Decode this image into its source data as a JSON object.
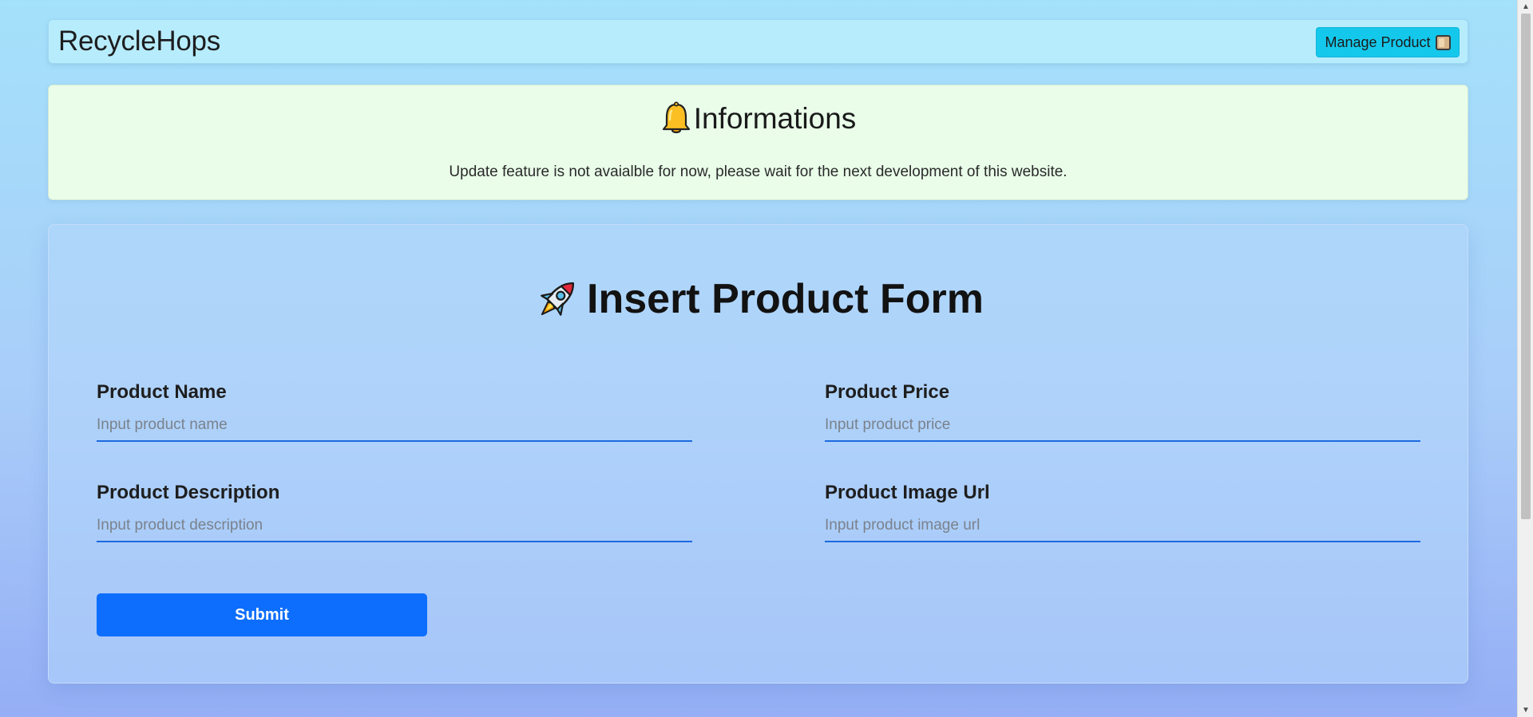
{
  "navbar": {
    "brand": "RecycleHops",
    "manage_button_label": "Manage Product",
    "manage_button_icon": "package-icon"
  },
  "info": {
    "icon": "bell-icon",
    "title": "Informations",
    "message": "Update feature is not avaialble for now, please wait for the next development of this website."
  },
  "form": {
    "icon": "rocket-icon",
    "title": "Insert Product Form",
    "fields": [
      {
        "label": "Product Name",
        "placeholder": "Input product name",
        "value": ""
      },
      {
        "label": "Product Price",
        "placeholder": "Input product price",
        "value": ""
      },
      {
        "label": "Product Description",
        "placeholder": "Input product description",
        "value": ""
      },
      {
        "label": "Product Image Url",
        "placeholder": "Input product image url",
        "value": ""
      }
    ],
    "submit_label": "Submit"
  },
  "colors": {
    "primary": "#0d6efd",
    "nav_button": "#14c8ec",
    "info_bg": "#e9fde9",
    "navbar_bg": "#b7ecfd"
  }
}
